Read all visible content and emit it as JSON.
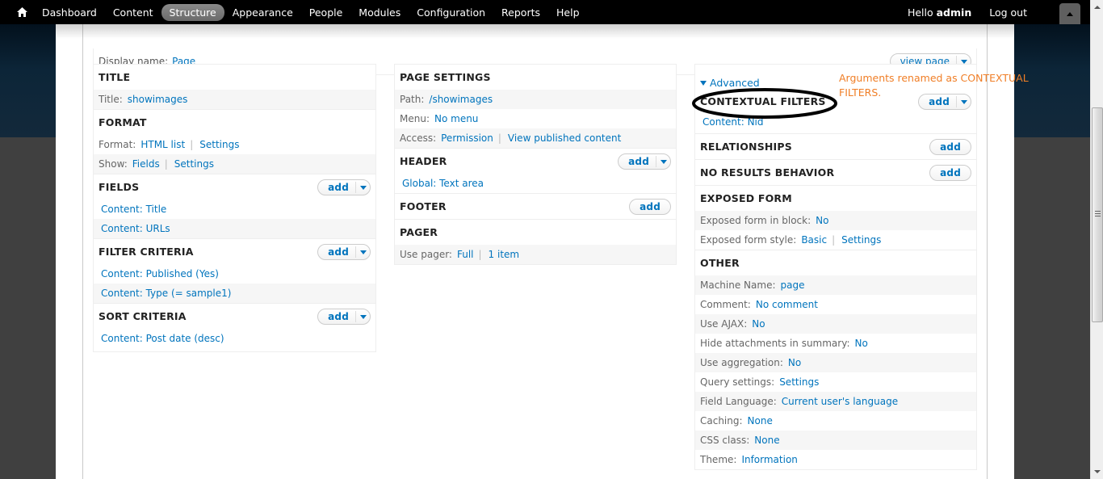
{
  "toolbar": {
    "home_icon": "home-icon",
    "menu": [
      {
        "label": "Dashboard",
        "active": false
      },
      {
        "label": "Content",
        "active": false
      },
      {
        "label": "Structure",
        "active": true
      },
      {
        "label": "Appearance",
        "active": false
      },
      {
        "label": "People",
        "active": false
      },
      {
        "label": "Modules",
        "active": false
      },
      {
        "label": "Configuration",
        "active": false
      },
      {
        "label": "Reports",
        "active": false
      },
      {
        "label": "Help",
        "active": false
      }
    ],
    "hello_prefix": "Hello",
    "username": "admin",
    "logout_label": "Log out",
    "drawer_icon": "triangle-up-icon"
  },
  "display": {
    "name_label": "Display name:",
    "name_value": "Page",
    "view_page_label": "view page"
  },
  "add_label": "add",
  "col1": {
    "title": {
      "heading": "TITLE",
      "label": "Title:",
      "value": "showimages"
    },
    "format": {
      "heading": "FORMAT",
      "format_label": "Format:",
      "format_value": "HTML list",
      "format_settings": "Settings",
      "show_label": "Show:",
      "show_value": "Fields",
      "show_settings": "Settings"
    },
    "fields": {
      "heading": "FIELDS",
      "items": [
        "Content: Title",
        "Content: URLs"
      ]
    },
    "filter": {
      "heading": "FILTER CRITERIA",
      "items": [
        "Content: Published (Yes)",
        "Content: Type (= sample1)"
      ]
    },
    "sort": {
      "heading": "SORT CRITERIA",
      "items": [
        "Content: Post date (desc)"
      ]
    }
  },
  "col2": {
    "page_settings": {
      "heading": "PAGE SETTINGS",
      "path_label": "Path:",
      "path_value": "/showimages",
      "menu_label": "Menu:",
      "menu_value": "No menu",
      "access_label": "Access:",
      "access_value": "Permission",
      "access_detail": "View published content"
    },
    "header": {
      "heading": "HEADER",
      "items": [
        "Global: Text area"
      ]
    },
    "footer": {
      "heading": "FOOTER"
    },
    "pager": {
      "heading": "PAGER",
      "label": "Use pager:",
      "value": "Full",
      "detail": "1 item"
    }
  },
  "col3": {
    "advanced_label": "Advanced",
    "contextual": {
      "heading": "CONTEXTUAL FILTERS",
      "items": [
        "Content: Nid"
      ]
    },
    "relationships": {
      "heading": "RELATIONSHIPS"
    },
    "no_results": {
      "heading": "NO RESULTS BEHAVIOR"
    },
    "exposed": {
      "heading": "EXPOSED FORM",
      "block_label": "Exposed form in block:",
      "block_value": "No",
      "style_label": "Exposed form style:",
      "style_value": "Basic",
      "style_settings": "Settings"
    },
    "other": {
      "heading": "OTHER",
      "rows": [
        {
          "label": "Machine Name:",
          "value": "page"
        },
        {
          "label": "Comment:",
          "value": "No comment"
        },
        {
          "label": "Use AJAX:",
          "value": "No"
        },
        {
          "label": "Hide attachments in summary:",
          "value": "No"
        },
        {
          "label": "Use aggregation:",
          "value": "No"
        },
        {
          "label": "Query settings:",
          "value": "Settings"
        },
        {
          "label": "Field Language:",
          "value": "Current user's language"
        },
        {
          "label": "Caching:",
          "value": "None"
        },
        {
          "label": "CSS class:",
          "value": "None"
        },
        {
          "label": "Theme:",
          "value": "Information"
        }
      ]
    }
  },
  "annotation": {
    "text": "Arguments renamed as CONTEXTUAL FILTERS.",
    "color": "#f07e26"
  },
  "colors": {
    "link": "#0074bd",
    "toolbar_bg": "#000000",
    "active_tab": "#7a7a7a"
  }
}
